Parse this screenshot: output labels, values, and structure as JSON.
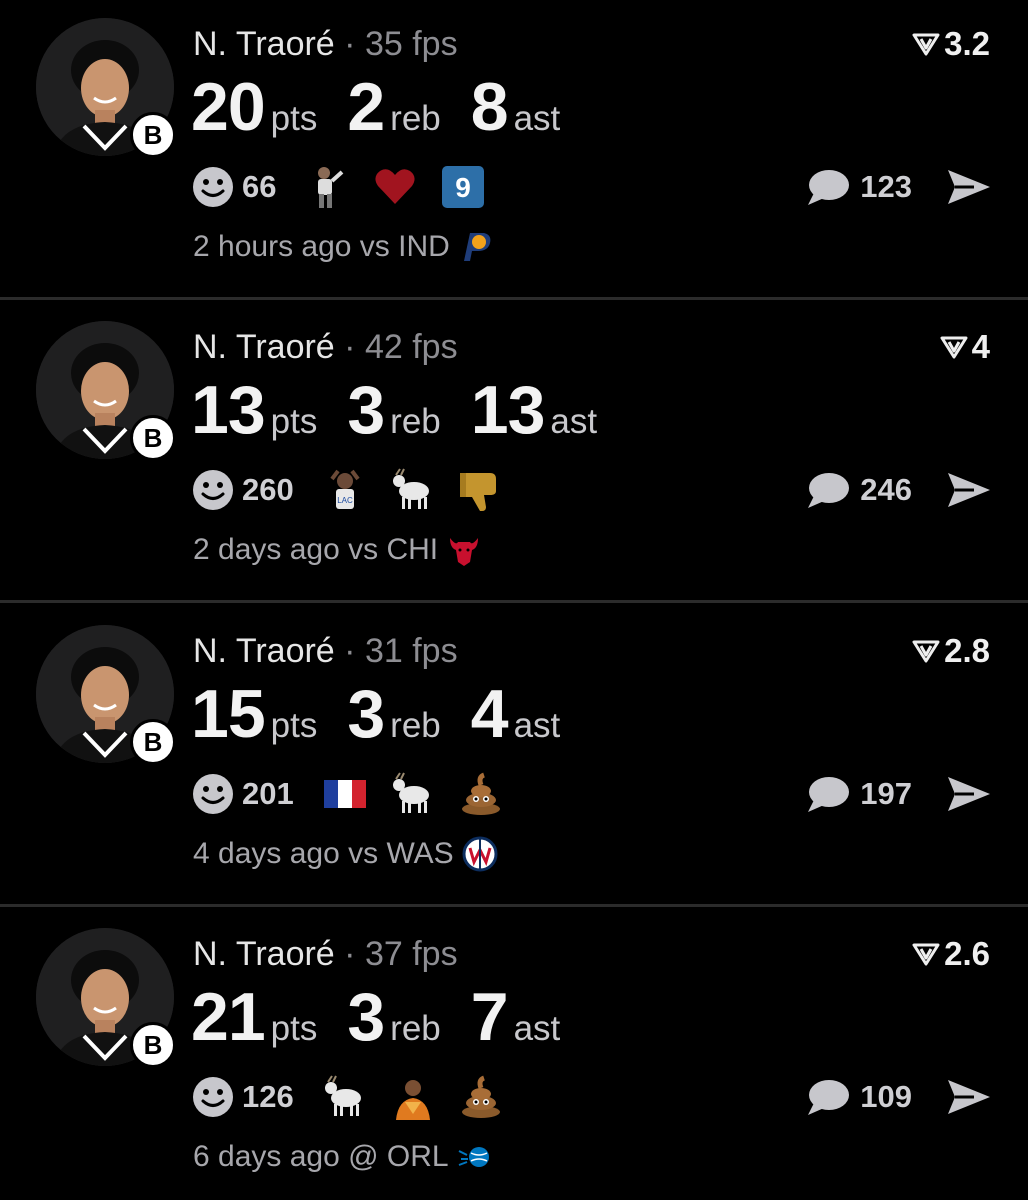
{
  "feed": {
    "posts": [
      {
        "player": "N. Traoré",
        "separator": "·",
        "fps": "35 fps",
        "rating": "3.2",
        "stats": [
          {
            "value": "20",
            "unit": "pts"
          },
          {
            "value": "2",
            "unit": "reb"
          },
          {
            "value": "8",
            "unit": "ast"
          }
        ],
        "reaction_count": "66",
        "emojis": [
          "player-photo",
          "heart",
          "number-9"
        ],
        "comment_count": "123",
        "time": "2 hours ago",
        "opponent_text": "vs IND",
        "opponent_logo": "pacers-logo"
      },
      {
        "player": "N. Traoré",
        "separator": "·",
        "fps": "42 fps",
        "rating": "4",
        "stats": [
          {
            "value": "13",
            "unit": "pts"
          },
          {
            "value": "3",
            "unit": "reb"
          },
          {
            "value": "13",
            "unit": "ast"
          }
        ],
        "reaction_count": "260",
        "emojis": [
          "player-photo",
          "goat",
          "thumbs-down"
        ],
        "comment_count": "246",
        "time": "2 days ago",
        "opponent_text": "vs CHI",
        "opponent_logo": "bulls-logo"
      },
      {
        "player": "N. Traoré",
        "separator": "·",
        "fps": "31 fps",
        "rating": "2.8",
        "stats": [
          {
            "value": "15",
            "unit": "pts"
          },
          {
            "value": "3",
            "unit": "reb"
          },
          {
            "value": "4",
            "unit": "ast"
          }
        ],
        "reaction_count": "201",
        "emojis": [
          "france-flag",
          "goat",
          "poop"
        ],
        "comment_count": "197",
        "time": "4 days ago",
        "opponent_text": "vs WAS",
        "opponent_logo": "wizards-logo"
      },
      {
        "player": "N. Traoré",
        "separator": "·",
        "fps": "37 fps",
        "rating": "2.6",
        "stats": [
          {
            "value": "21",
            "unit": "pts"
          },
          {
            "value": "3",
            "unit": "reb"
          },
          {
            "value": "7",
            "unit": "ast"
          }
        ],
        "reaction_count": "126",
        "emojis": [
          "goat",
          "person-photo",
          "poop"
        ],
        "comment_count": "109",
        "time": "6 days ago",
        "opponent_text": "@ ORL",
        "opponent_logo": "magic-logo"
      }
    ]
  },
  "colors": {
    "background": "#000000",
    "divider": "#2b2b2b",
    "muted": "#8d8d92",
    "icon": "#c7c7cc"
  }
}
